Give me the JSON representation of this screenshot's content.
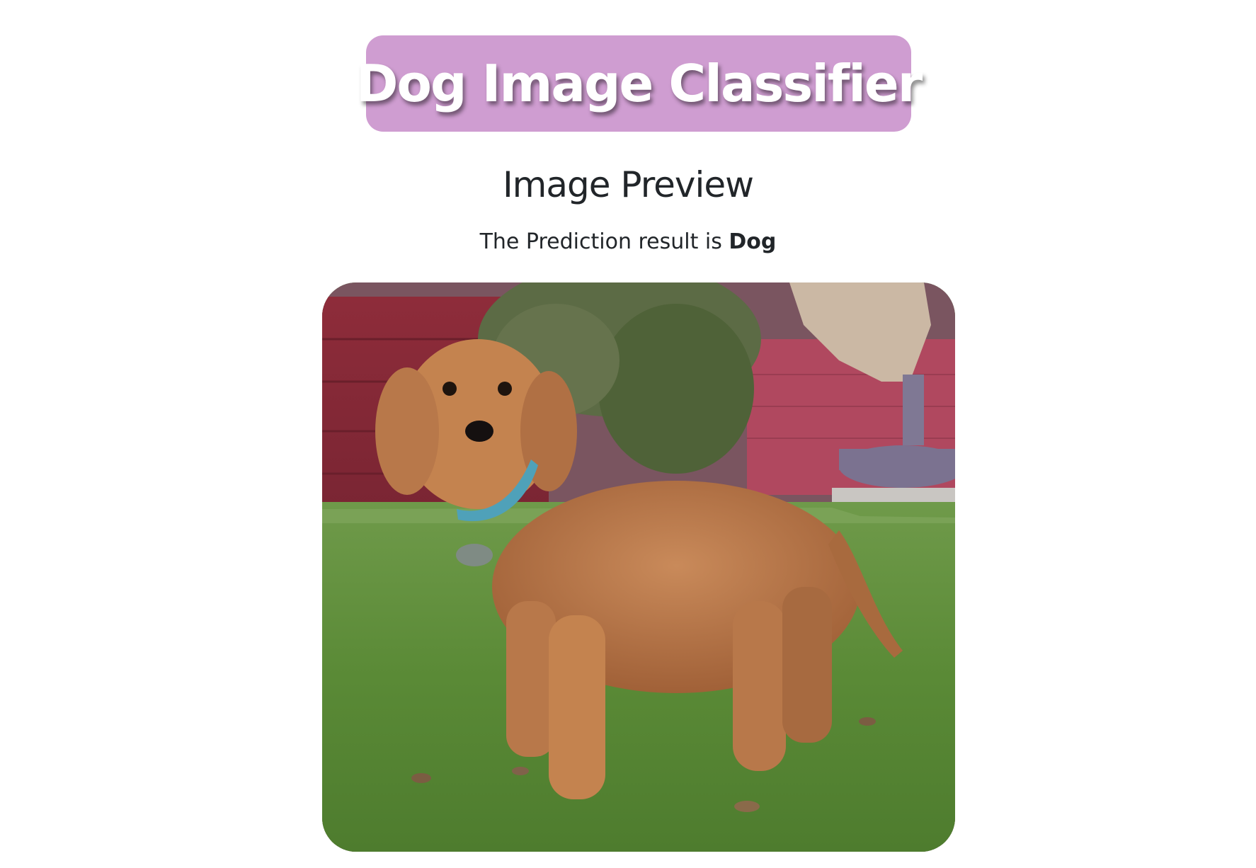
{
  "header": {
    "title": "Dog Image Classifier",
    "banner_color": "#cf9dd1"
  },
  "preview": {
    "heading": "Image Preview",
    "prediction_prefix": "The Prediction result is ",
    "prediction_value": "Dog"
  },
  "image": {
    "subject": "dog-photo",
    "corner_style": "rounded"
  }
}
